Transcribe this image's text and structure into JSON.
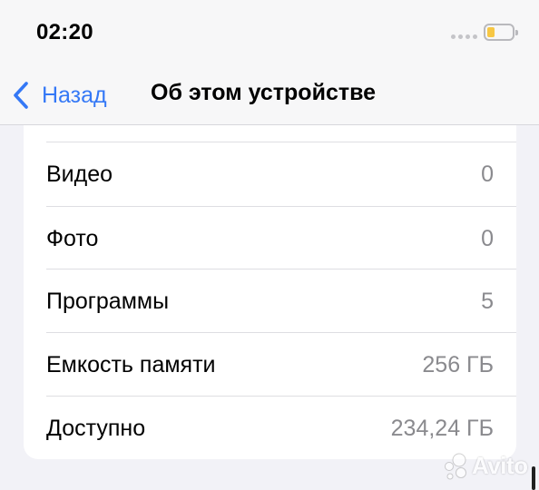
{
  "status_bar": {
    "time": "02:20",
    "battery_color": "#f7c744"
  },
  "nav": {
    "back_label": "Назад",
    "title": "Об этом устройстве",
    "accent_color": "#3478f6"
  },
  "rows": [
    {
      "label": "Видео",
      "value": "0"
    },
    {
      "label": "Фото",
      "value": "0"
    },
    {
      "label": "Программы",
      "value": "5"
    },
    {
      "label": "Емкость памяти",
      "value": "256 ГБ"
    },
    {
      "label": "Доступно",
      "value": "234,24 ГБ"
    }
  ],
  "watermark": {
    "text": "Avito"
  },
  "icons": {
    "back": "chevron-left-icon",
    "signal": "cellular-signal-icon",
    "battery": "battery-icon"
  }
}
